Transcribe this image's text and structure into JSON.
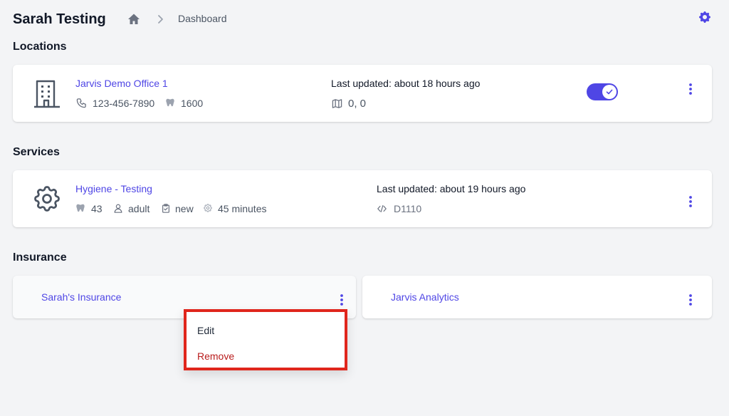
{
  "header": {
    "title": "Sarah Testing",
    "breadcrumb_current": "Dashboard"
  },
  "sections": {
    "locations_title": "Locations",
    "services_title": "Services",
    "insurance_title": "Insurance"
  },
  "location": {
    "name": "Jarvis Demo Office 1",
    "phone": "123-456-7890",
    "tooth_count": "1600",
    "last_updated": "Last updated: about 18 hours ago",
    "coordinates": "0, 0",
    "enabled": true
  },
  "service": {
    "name": "Hygiene - Testing",
    "tooth_count": "43",
    "patient_type": "adult",
    "status": "new",
    "duration": "45 minutes",
    "last_updated": "Last updated: about 19 hours ago",
    "code": "D1110"
  },
  "insurance": {
    "items": [
      {
        "name": "Sarah's Insurance"
      },
      {
        "name": "Jarvis Analytics"
      }
    ]
  },
  "context_menu": {
    "edit_label": "Edit",
    "remove_label": "Remove"
  },
  "colors": {
    "accent": "#4f46e5",
    "danger": "#b91c1c",
    "highlight_border": "#e0261c",
    "background": "#f3f4f6"
  },
  "icons": {
    "home": "home-icon",
    "breadcrumb_separator": "chevron-right-icon",
    "settings": "gear-icon",
    "location": "building-icon",
    "phone": "phone-icon",
    "tooth": "tooth-icon",
    "map": "map-icon",
    "service": "cog-icon",
    "user": "user-icon",
    "clipboard": "clipboard-check-icon",
    "duration": "cog-small-icon",
    "code": "code-icon",
    "menu": "kebab-menu-icon"
  }
}
